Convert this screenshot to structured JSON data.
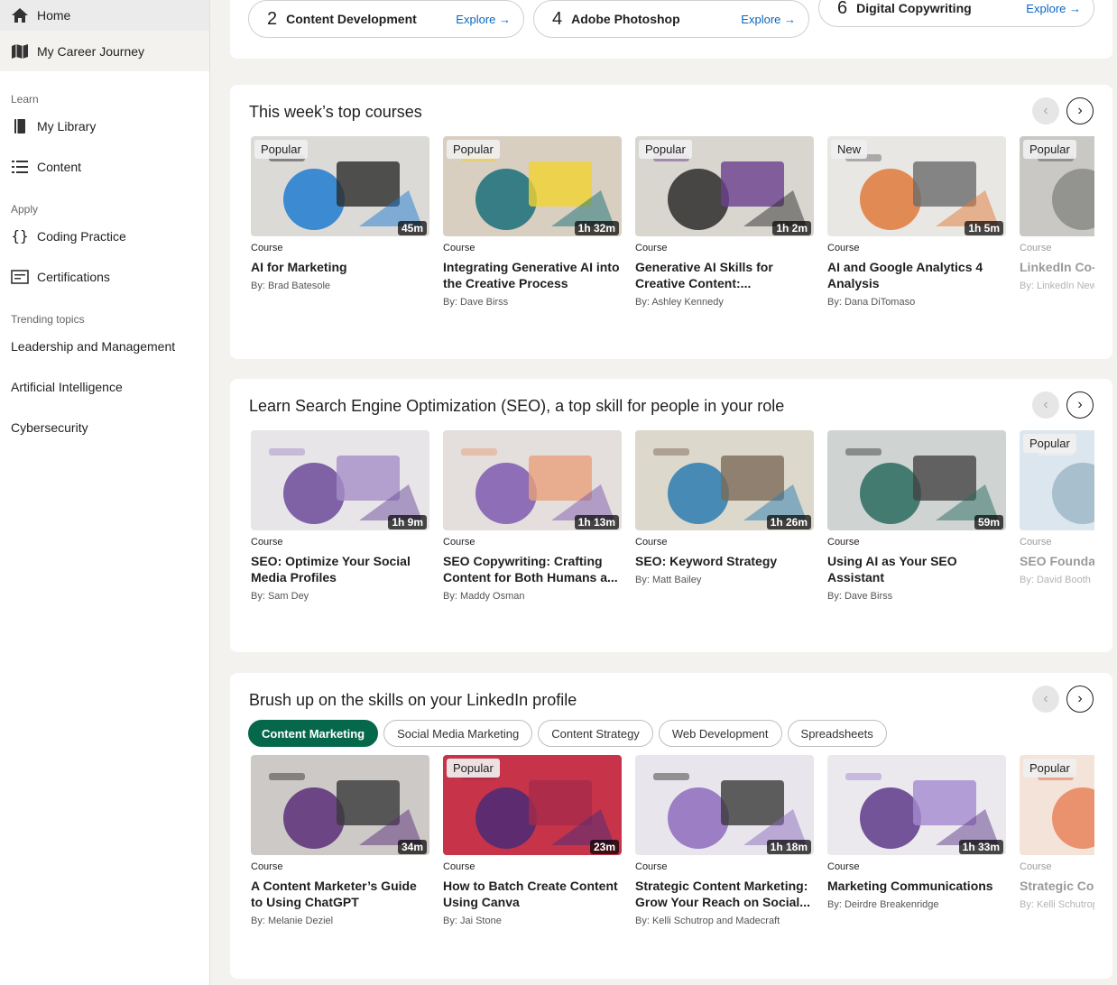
{
  "sidebar": {
    "home": "Home",
    "career": "My Career Journey",
    "learn_section": "Learn",
    "library": "My Library",
    "content": "Content",
    "apply_section": "Apply",
    "coding": "Coding Practice",
    "certs": "Certifications",
    "trending_section": "Trending topics",
    "topics": [
      "Leadership and Management",
      "Artificial Intelligence",
      "Cybersecurity"
    ]
  },
  "skill_pills": [
    {
      "num": "2",
      "label": "Content Development",
      "explore": "Explore →"
    },
    {
      "num": "4",
      "label": "Adobe Photoshop",
      "explore": "Explore →"
    },
    {
      "num": "6",
      "label": "Digital Copywriting",
      "explore": "Explore →"
    }
  ],
  "sections": [
    {
      "title": "This week’s top courses",
      "cards": [
        {
          "badge": "Popular",
          "dur": "45m",
          "type": "Course",
          "title": "AI for Marketing",
          "author": "By: Brad Batesole"
        },
        {
          "badge": "Popular",
          "dur": "1h 32m",
          "type": "Course",
          "title": "Integrating Generative AI into the Creative Process",
          "author": "By: Dave Birss"
        },
        {
          "badge": "Popular",
          "dur": "1h 2m",
          "type": "Course",
          "title": "Generative AI Skills for Creative Content:...",
          "author": "By: Ashley Kennedy"
        },
        {
          "badge": "New",
          "dur": "1h 5m",
          "type": "Course",
          "title": "AI and Google Analytics 4 Analysis",
          "author": "By: Dana DiTomaso"
        },
        {
          "badge": "Popular",
          "dur": "",
          "type": "Course",
          "title": "LinkedIn Co-Hoffman on",
          "author": "By: LinkedIn New"
        }
      ]
    },
    {
      "title": "Learn Search Engine Optimization (SEO), a top skill for people in your role",
      "cards": [
        {
          "badge": "",
          "dur": "1h 9m",
          "type": "Course",
          "title": "SEO: Optimize Your Social Media Profiles",
          "author": "By: Sam Dey"
        },
        {
          "badge": "",
          "dur": "1h 13m",
          "type": "Course",
          "title": "SEO Copywriting: Crafting Content for Both Humans a...",
          "author": "By: Maddy Osman"
        },
        {
          "badge": "",
          "dur": "1h 26m",
          "type": "Course",
          "title": "SEO: Keyword Strategy",
          "author": "By: Matt Bailey"
        },
        {
          "badge": "",
          "dur": "59m",
          "type": "Course",
          "title": "Using AI as Your SEO Assistant",
          "author": "By: Dave Birss"
        },
        {
          "badge": "Popular",
          "dur": "",
          "type": "Course",
          "title": "SEO Foundat",
          "author": "By: David Booth"
        }
      ]
    },
    {
      "title": "Brush up on the skills on your LinkedIn profile",
      "chips": [
        "Content Marketing",
        "Social Media Marketing",
        "Content Strategy",
        "Web Development",
        "Spreadsheets"
      ],
      "cards": [
        {
          "badge": "",
          "dur": "34m",
          "type": "Course",
          "title": "A Content Marketer’s Guide to Using ChatGPT",
          "author": "By: Melanie Deziel"
        },
        {
          "badge": "Popular",
          "dur": "23m",
          "type": "Course",
          "title": "How to Batch Create Content Using Canva",
          "author": "By: Jai Stone"
        },
        {
          "badge": "",
          "dur": "1h 18m",
          "type": "Course",
          "title": "Strategic Content Marketing: Grow Your Reach on Social...",
          "author": "By: Kelli Schutrop and Madecraft"
        },
        {
          "badge": "",
          "dur": "1h 33m",
          "type": "Course",
          "title": "Marketing Communications",
          "author": "By: Deirdre Breakenridge"
        },
        {
          "badge": "Popular",
          "dur": "",
          "type": "Course",
          "title": "Strategic Cor Attract, Enga",
          "author": "By: Kelli Schutrop"
        }
      ]
    }
  ],
  "nav_arrows": {
    "prev": "‹",
    "next": "›"
  },
  "thumb_colors": [
    [
      "#dcdad6",
      "#1f7bd1",
      "#2b2b2b"
    ],
    [
      "#d8cfc0",
      "#1a6f7a",
      "#f2d231"
    ],
    [
      "#d9d6d0",
      "#2d2d2d",
      "#6a3e8e"
    ],
    [
      "#e9e7e3",
      "#e0793a",
      "#6b6b6b"
    ],
    [
      "#c9c8c4",
      "#8a8a86",
      "#5a5a56"
    ],
    [
      "#e7e5e8",
      "#6b4b99",
      "#a68fc7"
    ],
    [
      "#e4dfdc",
      "#7e5ab0",
      "#e7a07a"
    ],
    [
      "#ddd8cc",
      "#2c7cb0",
      "#7c6a58"
    ],
    [
      "#cfd4d3",
      "#2a6b5f",
      "#444"
    ],
    [
      "#dce6ee",
      "#9fb7c8",
      "#f3f3f3"
    ],
    [
      "#ccc9c6",
      "#5a2f78",
      "#3a3a3a"
    ],
    [
      "#c7344a",
      "#4a2b77",
      "#a52a4a"
    ],
    [
      "#e8e6ec",
      "#8e6bbd",
      "#3a3a3a"
    ],
    [
      "#ebe9ee",
      "#5e3a8a",
      "#a58ad0"
    ],
    [
      "#f4e3d8",
      "#e8825c",
      "#d46a46"
    ]
  ]
}
